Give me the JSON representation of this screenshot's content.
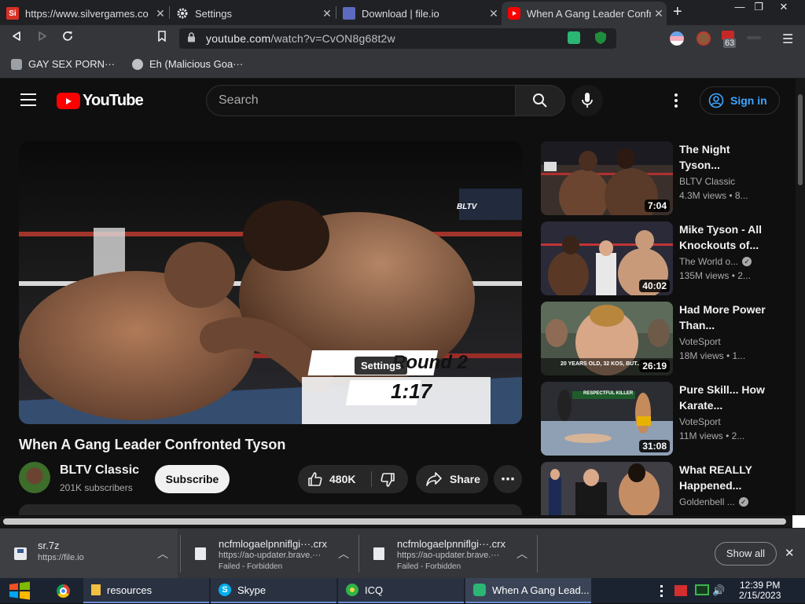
{
  "browser": {
    "tabs": [
      {
        "title": "https://www.silvergames.co",
        "favicon_text": "Si",
        "active": false
      },
      {
        "title": "Settings",
        "active": false
      },
      {
        "title": "Download | file.io",
        "active": false
      },
      {
        "title": "When A Gang Leader Confro",
        "active": true
      }
    ],
    "new_tab": "+",
    "window_controls": {
      "minimize": "—",
      "maximize": "❐",
      "close": "✕"
    },
    "url": {
      "host": "youtube.com",
      "path": "/watch?v=CvON8g68t2w"
    },
    "extension_badge": "63",
    "bookmarks": [
      "GAY SEX PORN···",
      "Eh (Malicious Goa···"
    ]
  },
  "youtube": {
    "logo_text": "YouTube",
    "search_placeholder": "Search",
    "sign_in": "Sign in",
    "player": {
      "watermark": "BLTV",
      "round_text": "Round 2",
      "clock_text": "1:17",
      "tooltip": "Settings"
    },
    "video_title": "When A Gang Leader Confronted Tyson",
    "channel": {
      "name": "BLTV Classic",
      "subscribers": "201K subscribers"
    },
    "subscribe": "Subscribe",
    "likes": "480K",
    "share": "Share",
    "more": "⋯",
    "recommended": [
      {
        "title": "The Night Tyson...",
        "channel": "BLTV Classic",
        "meta": "4.3M views  • 8...",
        "duration": "7:04",
        "verified": false
      },
      {
        "title": "Mike Tyson - All Knockouts of...",
        "channel": "The World o...",
        "meta": "135M views  • 2...",
        "duration": "40:02",
        "verified": true
      },
      {
        "title": "Had More Power Than...",
        "channel": "VoteSport",
        "meta": "18M views  • 1...",
        "duration": "26:19",
        "verified": false,
        "thumb_caption": "20 YEARS OLD, 32 KOS, BUT..."
      },
      {
        "title": "Pure Skill... How Karate...",
        "channel": "VoteSport",
        "meta": "11M views  • 2...",
        "duration": "31:08",
        "verified": false,
        "thumb_caption": "RESPECTFUL KILLER"
      },
      {
        "title": "What REALLY Happened...",
        "channel": "Goldenbell ...",
        "meta": "",
        "duration": "",
        "verified": true
      }
    ]
  },
  "downloads": {
    "items": [
      {
        "filename": "sr.7z",
        "source": "https://file.io",
        "status": ""
      },
      {
        "filename": "ncfmlogaelpnniflgi···.crx",
        "source": "https://ao-updater.brave.···",
        "status": "Failed - Forbidden"
      },
      {
        "filename": "ncfmlogaelpnniflgi···.crx",
        "source": "https://ao-updater.brave.···",
        "status": "Failed - Forbidden"
      }
    ],
    "show_all": "Show all"
  },
  "taskbar": {
    "items": [
      "resources",
      "Skype",
      "ICQ",
      "When A Gang Lead..."
    ],
    "time": "12:39 PM",
    "date": "2/15/2023"
  },
  "colors": {
    "youtube_red": "#ff0000",
    "link_blue": "#3ea6ff",
    "chrome_dark": "#35363a"
  }
}
